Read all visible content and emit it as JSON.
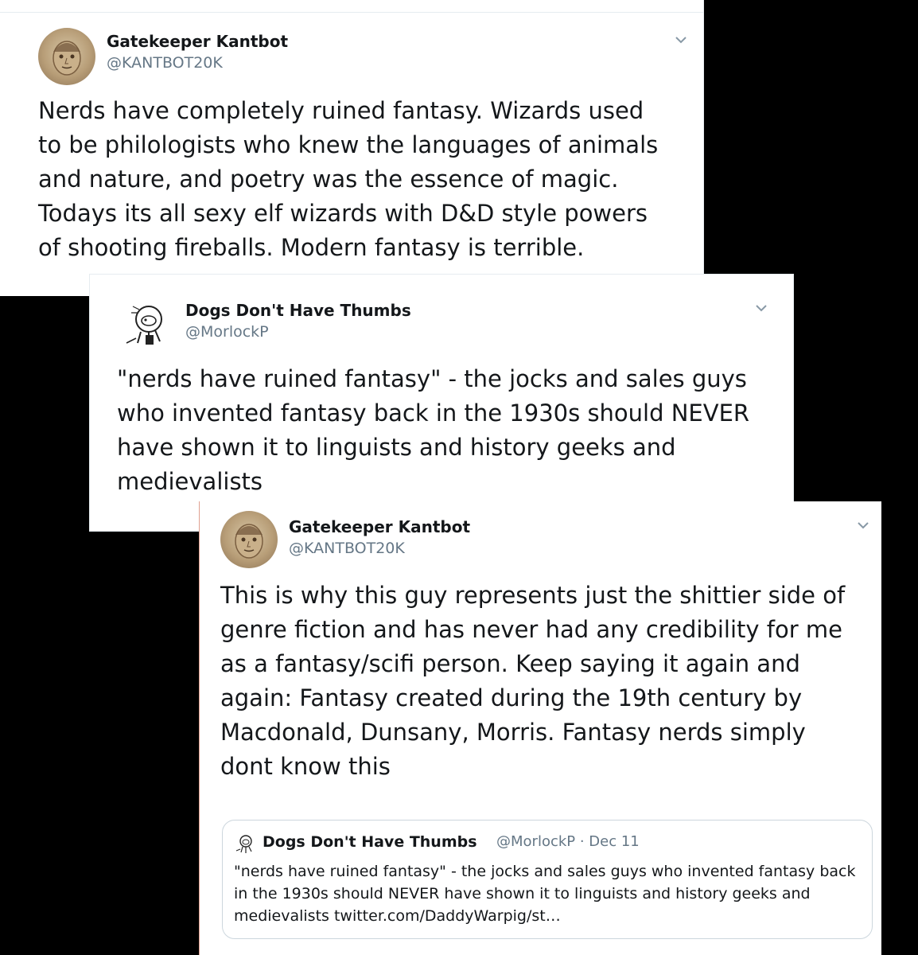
{
  "tweets": [
    {
      "author_name": "Gatekeeper Kantbot",
      "author_handle": "@KANTBOT20K",
      "text": "Nerds have completely ruined fantasy. Wizards used\nto be philologists who knew the languages of animals\nand nature, and poetry was the essence of magic.\nTodays its all sexy elf wizards with D&D style powers\nof shooting fireballs. Modern fantasy is terrible.",
      "avatar_icon": "portrait-avatar"
    },
    {
      "author_name": "Dogs Don't Have Thumbs",
      "author_handle": "@MorlockP",
      "text": "\"nerds have ruined fantasy\" - the jocks and sales guys\nwho invented fantasy back in the 1930s should NEVER\nhave shown it to linguists and history geeks and\nmedievalists",
      "avatar_icon": "dog-sketch-avatar"
    },
    {
      "author_name": "Gatekeeper Kantbot",
      "author_handle": "@KANTBOT20K",
      "text": "This is why this guy represents just the shittier side of\ngenre fiction and has never had any credibility for me\nas a fantasy/scifi person. Keep saying it again and\nagain: Fantasy created during the 19th century by\nMacdonald, Dunsany, Morris. Fantasy nerds simply\ndont know this",
      "avatar_icon": "portrait-avatar",
      "quoted_tweet": {
        "author_name": "Dogs Don't Have Thumbs",
        "author_handle_date": "@MorlockP · Dec 11",
        "text": "\"nerds have ruined fantasy\" - the jocks and sales guys who invented fantasy back in the 1930s should NEVER have shown it to linguists and history geeks and medievalists twitter.com/DaddyWarpig/st…"
      }
    }
  ],
  "colors": {
    "background": "#000000",
    "card": "#ffffff",
    "secondary_text": "#657786",
    "border": "#ccd6dd"
  }
}
